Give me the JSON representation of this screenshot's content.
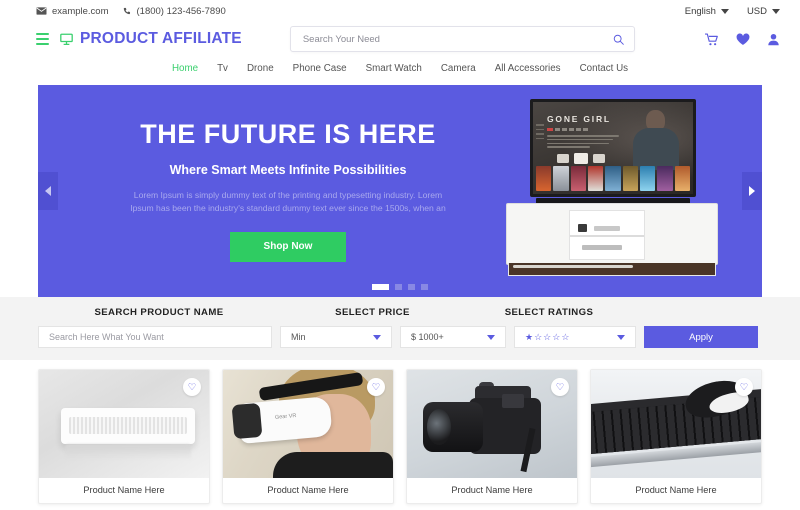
{
  "topbar": {
    "email": "example.com",
    "phone": "(1800) 123-456-7890",
    "language": "English",
    "currency": "USD"
  },
  "header": {
    "brand": "PRODUCT AFFILIATE",
    "search_placeholder": "Search Your Need",
    "search_value": ""
  },
  "nav": {
    "items": [
      {
        "label": "Home",
        "active": true
      },
      {
        "label": "Tv",
        "active": false
      },
      {
        "label": "Drone",
        "active": false
      },
      {
        "label": "Phone Case",
        "active": false
      },
      {
        "label": "Smart Watch",
        "active": false
      },
      {
        "label": "Camera",
        "active": false
      },
      {
        "label": "All Accessories",
        "active": false
      },
      {
        "label": "Contact Us",
        "active": false
      }
    ]
  },
  "hero": {
    "title": "THE FUTURE IS HERE",
    "subtitle": "Where Smart Meets Infinite Possibilities",
    "description": "Lorem Ipsum is simply dummy text of the printing and typesetting industry. Lorem Ipsum has been the industry's standard dummy text ever since the 1500s, when an",
    "cta": "Shop Now",
    "tv_movie_title": "GONE GIRL",
    "slide_count": 4,
    "active_slide": 1,
    "accent_color": "#5b5be0",
    "cta_color": "#2fcc62"
  },
  "filters": {
    "labels": {
      "name": "SEARCH PRODUCT NAME",
      "price": "SELECT PRICE",
      "ratings": "SELECT RATINGS"
    },
    "name_placeholder": "Search Here What You Want",
    "name_value": "",
    "price_min": "Min",
    "price_max": "$ 1000+",
    "rating_value": 1,
    "rating_max": 5,
    "apply_label": "Apply"
  },
  "products": [
    {
      "name": "Product Name Here",
      "image": "white-air-conditioner"
    },
    {
      "name": "Product Name Here",
      "image": "vr-headset-woman"
    },
    {
      "name": "Product Name Here",
      "image": "dslr-camera"
    },
    {
      "name": "Product Name Here",
      "image": "keyboard-and-mouse"
    }
  ],
  "icons": {
    "mail": "mail-icon",
    "phone": "phone-icon",
    "menu": "hamburger-icon",
    "logo": "monitor-icon",
    "search": "search-icon",
    "cart": "cart-icon",
    "wishlist": "heart-icon",
    "account": "user-icon"
  }
}
